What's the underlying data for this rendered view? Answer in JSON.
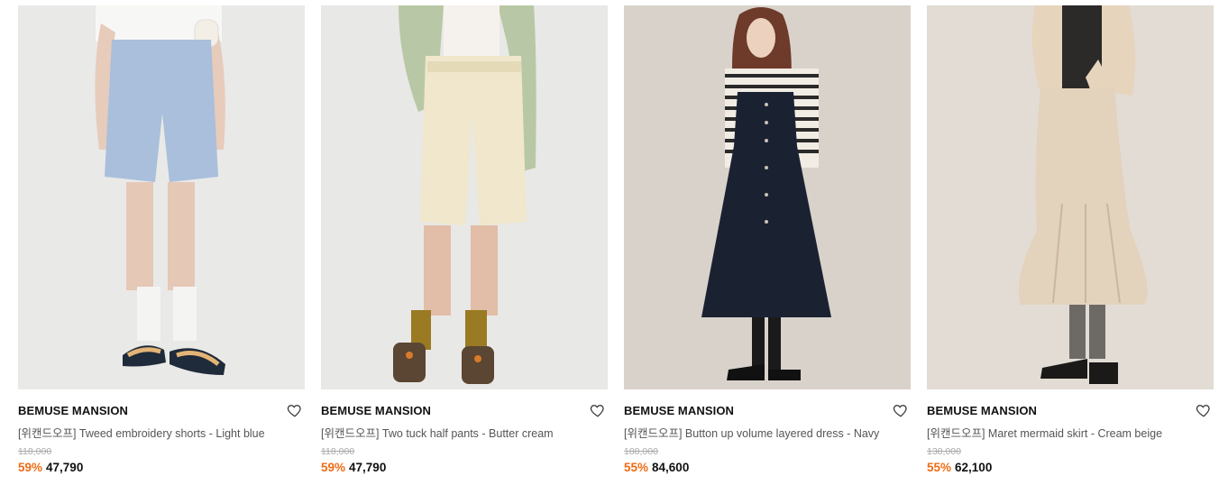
{
  "products": [
    {
      "brand": "BEMUSE MANSION",
      "title": "[위캔드오프] Tweed embroidery shorts - Light blue",
      "original_price": "118,000",
      "discount": "59%",
      "price": "47,790",
      "image_icon": "model-photo-light-blue-shorts",
      "bg": "#e9e9e7"
    },
    {
      "brand": "BEMUSE MANSION",
      "title": "[위캔드오프] Two tuck half pants - Butter cream",
      "original_price": "118,000",
      "discount": "59%",
      "price": "47,790",
      "image_icon": "model-photo-butter-cream-pants",
      "bg": "#e8e8e6"
    },
    {
      "brand": "BEMUSE MANSION",
      "title": "[위캔드오프] Button up volume layered dress - Navy",
      "original_price": "188,000",
      "discount": "55%",
      "price": "84,600",
      "image_icon": "model-photo-navy-dress",
      "bg": "#d9d2cb"
    },
    {
      "brand": "BEMUSE MANSION",
      "title": "[위캔드오프] Maret mermaid skirt - Cream beige",
      "original_price": "138,000",
      "discount": "55%",
      "price": "62,100",
      "image_icon": "model-photo-cream-beige-skirt",
      "bg": "#e2dcd5"
    }
  ],
  "colors": {
    "discount": "#ef6c16",
    "text": "#111111",
    "muted": "#555555",
    "strike": "#aaaaaa"
  },
  "icons": {
    "wishlist": "heart-outline-icon"
  }
}
